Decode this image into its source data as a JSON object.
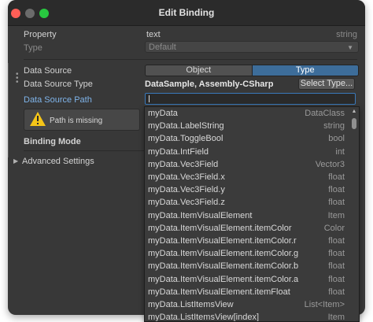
{
  "window": {
    "title": "Edit Binding"
  },
  "property": {
    "label": "Property",
    "value": "text",
    "type": "string"
  },
  "type_field": {
    "label": "Type",
    "value": "Default"
  },
  "data_source": {
    "label": "Data Source",
    "options": [
      "Object",
      "Type"
    ],
    "selected": "Type"
  },
  "data_source_type": {
    "label": "Data Source Type",
    "value": "DataSample, Assembly-CSharp",
    "button_label": "Select Type..."
  },
  "data_source_path": {
    "label": "Data Source Path",
    "value": ""
  },
  "warning": {
    "text": "Path is missing"
  },
  "binding_mode": {
    "label": "Binding Mode"
  },
  "advanced": {
    "label": "Advanced Settings"
  },
  "path_options": [
    {
      "name": "myData",
      "type": "DataClass"
    },
    {
      "name": "myData.LabelString",
      "type": "string"
    },
    {
      "name": "myData.ToggleBool",
      "type": "bool"
    },
    {
      "name": "myData.IntField",
      "type": "int"
    },
    {
      "name": "myData.Vec3Field",
      "type": "Vector3"
    },
    {
      "name": "myData.Vec3Field.x",
      "type": "float"
    },
    {
      "name": "myData.Vec3Field.y",
      "type": "float"
    },
    {
      "name": "myData.Vec3Field.z",
      "type": "float"
    },
    {
      "name": "myData.ItemVisualElement",
      "type": "Item"
    },
    {
      "name": "myData.ItemVisualElement.itemColor",
      "type": "Color"
    },
    {
      "name": "myData.ItemVisualElement.itemColor.r",
      "type": "float"
    },
    {
      "name": "myData.ItemVisualElement.itemColor.g",
      "type": "float"
    },
    {
      "name": "myData.ItemVisualElement.itemColor.b",
      "type": "float"
    },
    {
      "name": "myData.ItemVisualElement.itemColor.a",
      "type": "float"
    },
    {
      "name": "myData.ItemVisualElement.itemFloat",
      "type": "float"
    },
    {
      "name": "myData.ListItemsView",
      "type": "List<Item>"
    },
    {
      "name": "myData.ListItemsView[index]",
      "type": "Item"
    }
  ],
  "colors": {
    "accent": "#3d6d9a",
    "label_blue": "#7fb4ea",
    "warning": "#f5c518"
  },
  "icons": {
    "warning": "warning-triangle-icon",
    "foldout": "triangle-right-icon",
    "dropdown": "chevron-down-icon"
  }
}
